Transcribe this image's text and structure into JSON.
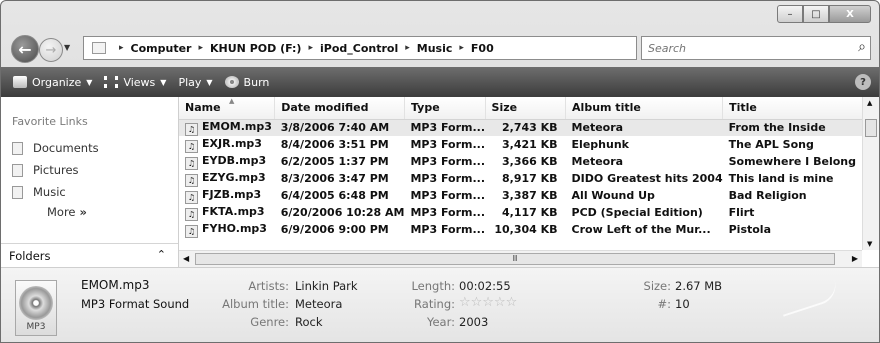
{
  "window": {
    "minimize": "–",
    "maximize": "□",
    "close": "X"
  },
  "address": {
    "crumbs": [
      "Computer",
      "KHUN POD (F:)",
      "iPod_Control",
      "Music",
      "F00"
    ],
    "search_placeholder": "Search"
  },
  "toolbar": {
    "organize": "Organize",
    "views": "Views",
    "play": "Play",
    "burn": "Burn",
    "help": "?"
  },
  "nav": {
    "favorite_links": "Favorite Links",
    "items": [
      "Documents",
      "Pictures",
      "Music"
    ],
    "more": "More",
    "more_arrow": "»",
    "folders": "Folders"
  },
  "columns": [
    "Name",
    "Date modified",
    "Type",
    "Size",
    "Album title",
    "Title"
  ],
  "files": [
    {
      "name": "EMOM.mp3",
      "date": "3/8/2006 7:40 AM",
      "type": "MP3 Form...",
      "size": "2,743 KB",
      "album": "Meteora",
      "title": "From the Inside"
    },
    {
      "name": "EXJR.mp3",
      "date": "8/4/2006 3:51 PM",
      "type": "MP3 Form...",
      "size": "3,421 KB",
      "album": "Elephunk",
      "title": "The APL Song"
    },
    {
      "name": "EYDB.mp3",
      "date": "6/2/2005 1:37 PM",
      "type": "MP3 Form...",
      "size": "3,366 KB",
      "album": "Meteora",
      "title": "Somewhere I Belong"
    },
    {
      "name": "EZYG.mp3",
      "date": "8/3/2006 3:47 PM",
      "type": "MP3 Form...",
      "size": "8,917 KB",
      "album": "DIDO Greatest hits 2004",
      "title": "This land is mine"
    },
    {
      "name": "FJZB.mp3",
      "date": "6/4/2005 6:48 PM",
      "type": "MP3 Form...",
      "size": "3,387 KB",
      "album": "All Wound Up",
      "title": "Bad Religion"
    },
    {
      "name": "FKTA.mp3",
      "date": "6/20/2006 10:28 AM",
      "type": "MP3 Form...",
      "size": "4,117 KB",
      "album": "PCD (Special Edition)",
      "title": "Flirt"
    },
    {
      "name": "FYHO.mp3",
      "date": "6/9/2006 9:00 PM",
      "type": "MP3 Form...",
      "size": "10,304 KB",
      "album": "Crow Left of the Mur...",
      "title": "Pistola"
    }
  ],
  "details": {
    "filename": "EMOM.mp3",
    "filetype": "MP3 Format Sound",
    "thumb_label": "MP3",
    "artists_label": "Artists:",
    "artists": "Linkin Park",
    "album_label": "Album title:",
    "album": "Meteora",
    "genre_label": "Genre:",
    "genre": "Rock",
    "length_label": "Length:",
    "length": "00:02:55",
    "rating_label": "Rating:",
    "rating_stars": "☆☆☆☆☆",
    "year_label": "Year:",
    "year": "2003",
    "size_label": "Size:",
    "size": "2.67 MB",
    "track_label": "#:",
    "track": "10"
  }
}
